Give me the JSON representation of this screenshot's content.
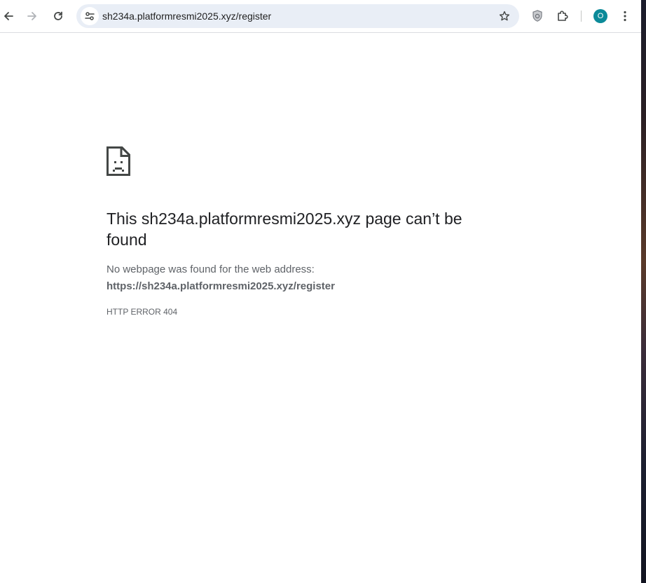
{
  "toolbar": {
    "back_icon": "arrow-left-icon",
    "forward_icon": "arrow-right-icon",
    "reload_icon": "reload-icon",
    "site_info_icon": "tune-icon",
    "url": "sh234a.platformresmi2025.xyz/register",
    "bookmark_icon": "star-icon",
    "shield_icon": "shield-icon",
    "extensions_icon": "puzzle-icon",
    "profile_initial": "O",
    "profile_color": "#0b8a99",
    "menu_icon": "kebab-menu-icon"
  },
  "error_page": {
    "icon": "sad-page-icon",
    "title": "This sh234a.platformresmi2025.xyz page can’t be found",
    "description": "No webpage was found for the web address:",
    "url": "https://sh234a.platformresmi2025.xyz/register",
    "code": "HTTP ERROR 404"
  }
}
